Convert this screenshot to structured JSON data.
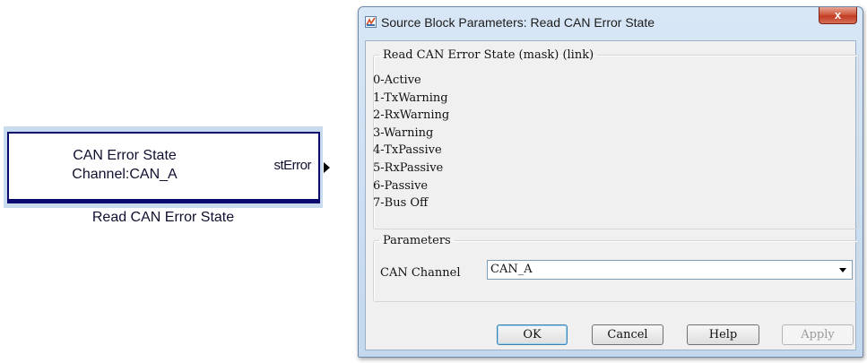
{
  "block": {
    "line1": "CAN Error State",
    "line2": "Channel:CAN_A",
    "port_label": "stError",
    "caption": "Read CAN Error State"
  },
  "dialog": {
    "title": "Source Block Parameters: Read CAN Error State",
    "close_label": "x",
    "description_group": "Read CAN Error State (mask) (link)",
    "states": [
      "0-Active",
      "1-TxWarning",
      "2-RxWarning",
      "3-Warning",
      "4-TxPassive",
      "5-RxPassive",
      "6-Passive",
      "7-Bus Off"
    ],
    "parameters_group": "Parameters",
    "can_channel_label": "CAN Channel",
    "can_channel_value": "CAN_A",
    "buttons": {
      "ok": "OK",
      "cancel": "Cancel",
      "help": "Help",
      "apply": "Apply"
    }
  },
  "colors": {
    "block_border": "#0a0a6e",
    "selection_highlight": "#c9dcee",
    "close_button": "#c9452c"
  }
}
